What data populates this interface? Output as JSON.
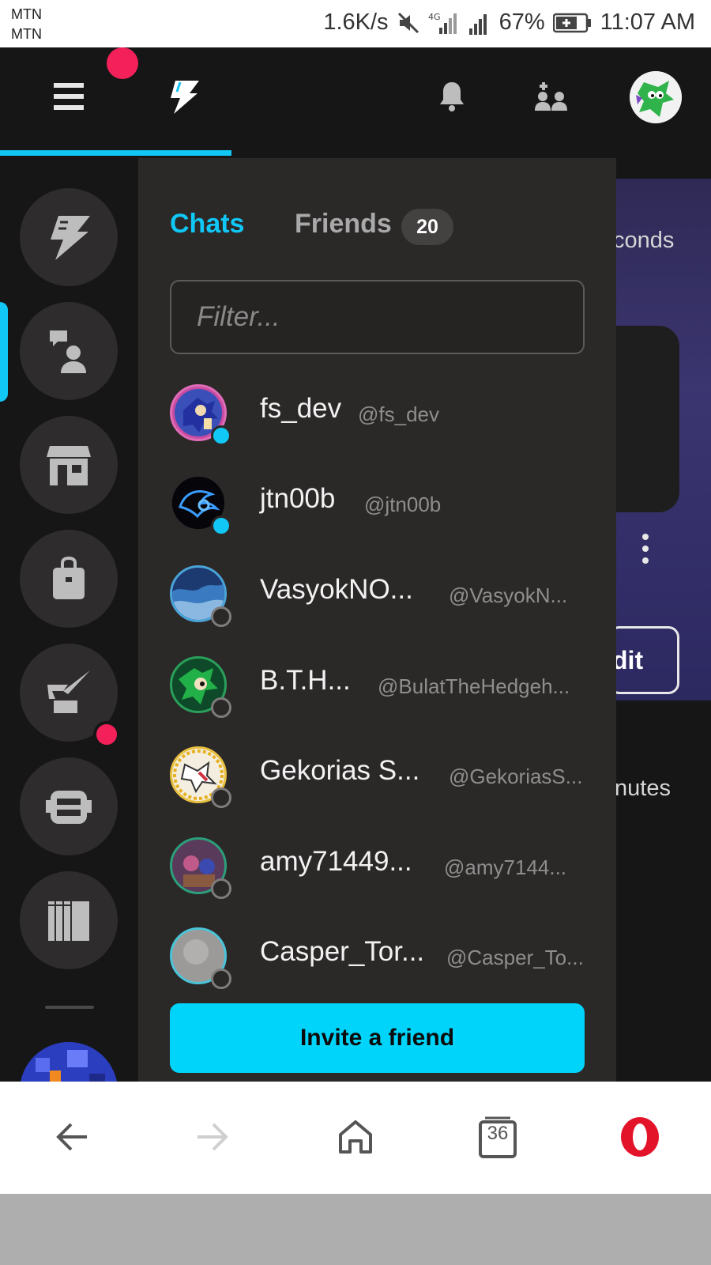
{
  "status_bar": {
    "carrier_1": "MTN",
    "carrier_2": "MTN",
    "speed": "1.6K/s",
    "battery": "67%",
    "time": "11:07 AM"
  },
  "header": {
    "menu_icon": "hamburger-icon",
    "logo_icon": "bolt-logo-icon",
    "notifications_icon": "bell-icon",
    "add_friend_icon": "add-friend-icon"
  },
  "rail": {
    "items": [
      {
        "name": "home",
        "icon": "bolt-icon"
      },
      {
        "name": "social",
        "icon": "chat-person-icon"
      },
      {
        "name": "store",
        "icon": "storefront-icon"
      },
      {
        "name": "inventory",
        "icon": "bag-icon"
      },
      {
        "name": "create",
        "icon": "quill-icon"
      },
      {
        "name": "bots",
        "icon": "robot-icon"
      },
      {
        "name": "library",
        "icon": "library-icon"
      }
    ]
  },
  "panel": {
    "tab_chats": "Chats",
    "tab_friends": "Friends",
    "friends_count": "20",
    "filter_placeholder": "Filter...",
    "invite_label": "Invite a friend"
  },
  "friends": [
    {
      "name": "fs_dev",
      "handle": "@fs_dev",
      "online": true
    },
    {
      "name": "jtn00b",
      "handle": "@jtn00b",
      "online": true
    },
    {
      "name": "VasyokNO...",
      "handle": "@VasyokN...",
      "online": false
    },
    {
      "name": "B.T.H...",
      "handle": "@BulatTheHedgeh...",
      "online": false
    },
    {
      "name": "Gekorias S...",
      "handle": "@GekoriasS...",
      "online": false
    },
    {
      "name": "amy71449...",
      "handle": "@amy7144...",
      "online": false
    },
    {
      "name": "Casper_Tor...",
      "handle": "@Casper_To...",
      "online": false
    }
  ],
  "background": {
    "text_1": "conds",
    "edit_label": "dit",
    "text_2": "nutes"
  },
  "browser": {
    "tabs_count": "36"
  },
  "colors": {
    "accent": "#11c7f5",
    "notification": "#f4205a",
    "panel": "#2b2828",
    "opera_red": "#e3142a"
  }
}
